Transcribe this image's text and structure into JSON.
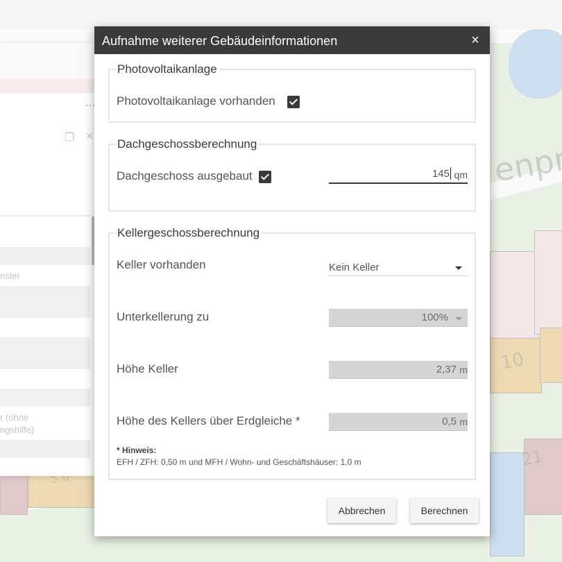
{
  "dialog": {
    "title": "Aufnahme weiterer Gebäudeinformationen",
    "close_symbol": "×"
  },
  "photovoltaik": {
    "legend": "Photovoltaikanlage",
    "checkbox_label": "Photovoltaikanlage vorhanden",
    "checked": true
  },
  "dachgeschoss": {
    "legend": "Dachgeschossberechnung",
    "checkbox_label": "Dachgeschoss ausgebaut",
    "checked": true,
    "area_value": "145",
    "area_unit": "qm"
  },
  "keller": {
    "legend": "Kellergeschossberechnung",
    "vorhanden_label": "Keller vorhanden",
    "vorhanden_value": "Kein Keller",
    "unterkellerung_label": "Unterkellerung zu",
    "unterkellerung_value": "100%",
    "hoehe_label": "Höhe Keller",
    "hoehe_value": "2,37",
    "hoehe_unit": "m",
    "ueber_erd_label": "Höhe des Kellers über Erdgleiche *",
    "ueber_erd_value": "0,5",
    "ueber_erd_unit": "m"
  },
  "hint": {
    "title": "* Hinweis:",
    "text": "EFH / ZFH: 0,50 m und MFH / Wohn- und Geschäftshäuser: 1,0 m"
  },
  "buttons": {
    "cancel": "Abbrechen",
    "calculate": "Berechnen"
  },
  "background": {
    "map_label_street": "enpr",
    "map_label_num_1": "10",
    "map_label_num_2": "21",
    "map_label_num_3": "5 0",
    "panel_text_1": "nster",
    "panel_text_2": "r (ohne",
    "panel_text_3": "ngshilfe)",
    "panel_dots": "⋯",
    "restore_icon": "❐",
    "close_icon": "×"
  },
  "colors": {
    "header_bg": "#3a3a3a",
    "checkbox": "#3a3a3a",
    "disabled_field": "#d5d5d5"
  }
}
